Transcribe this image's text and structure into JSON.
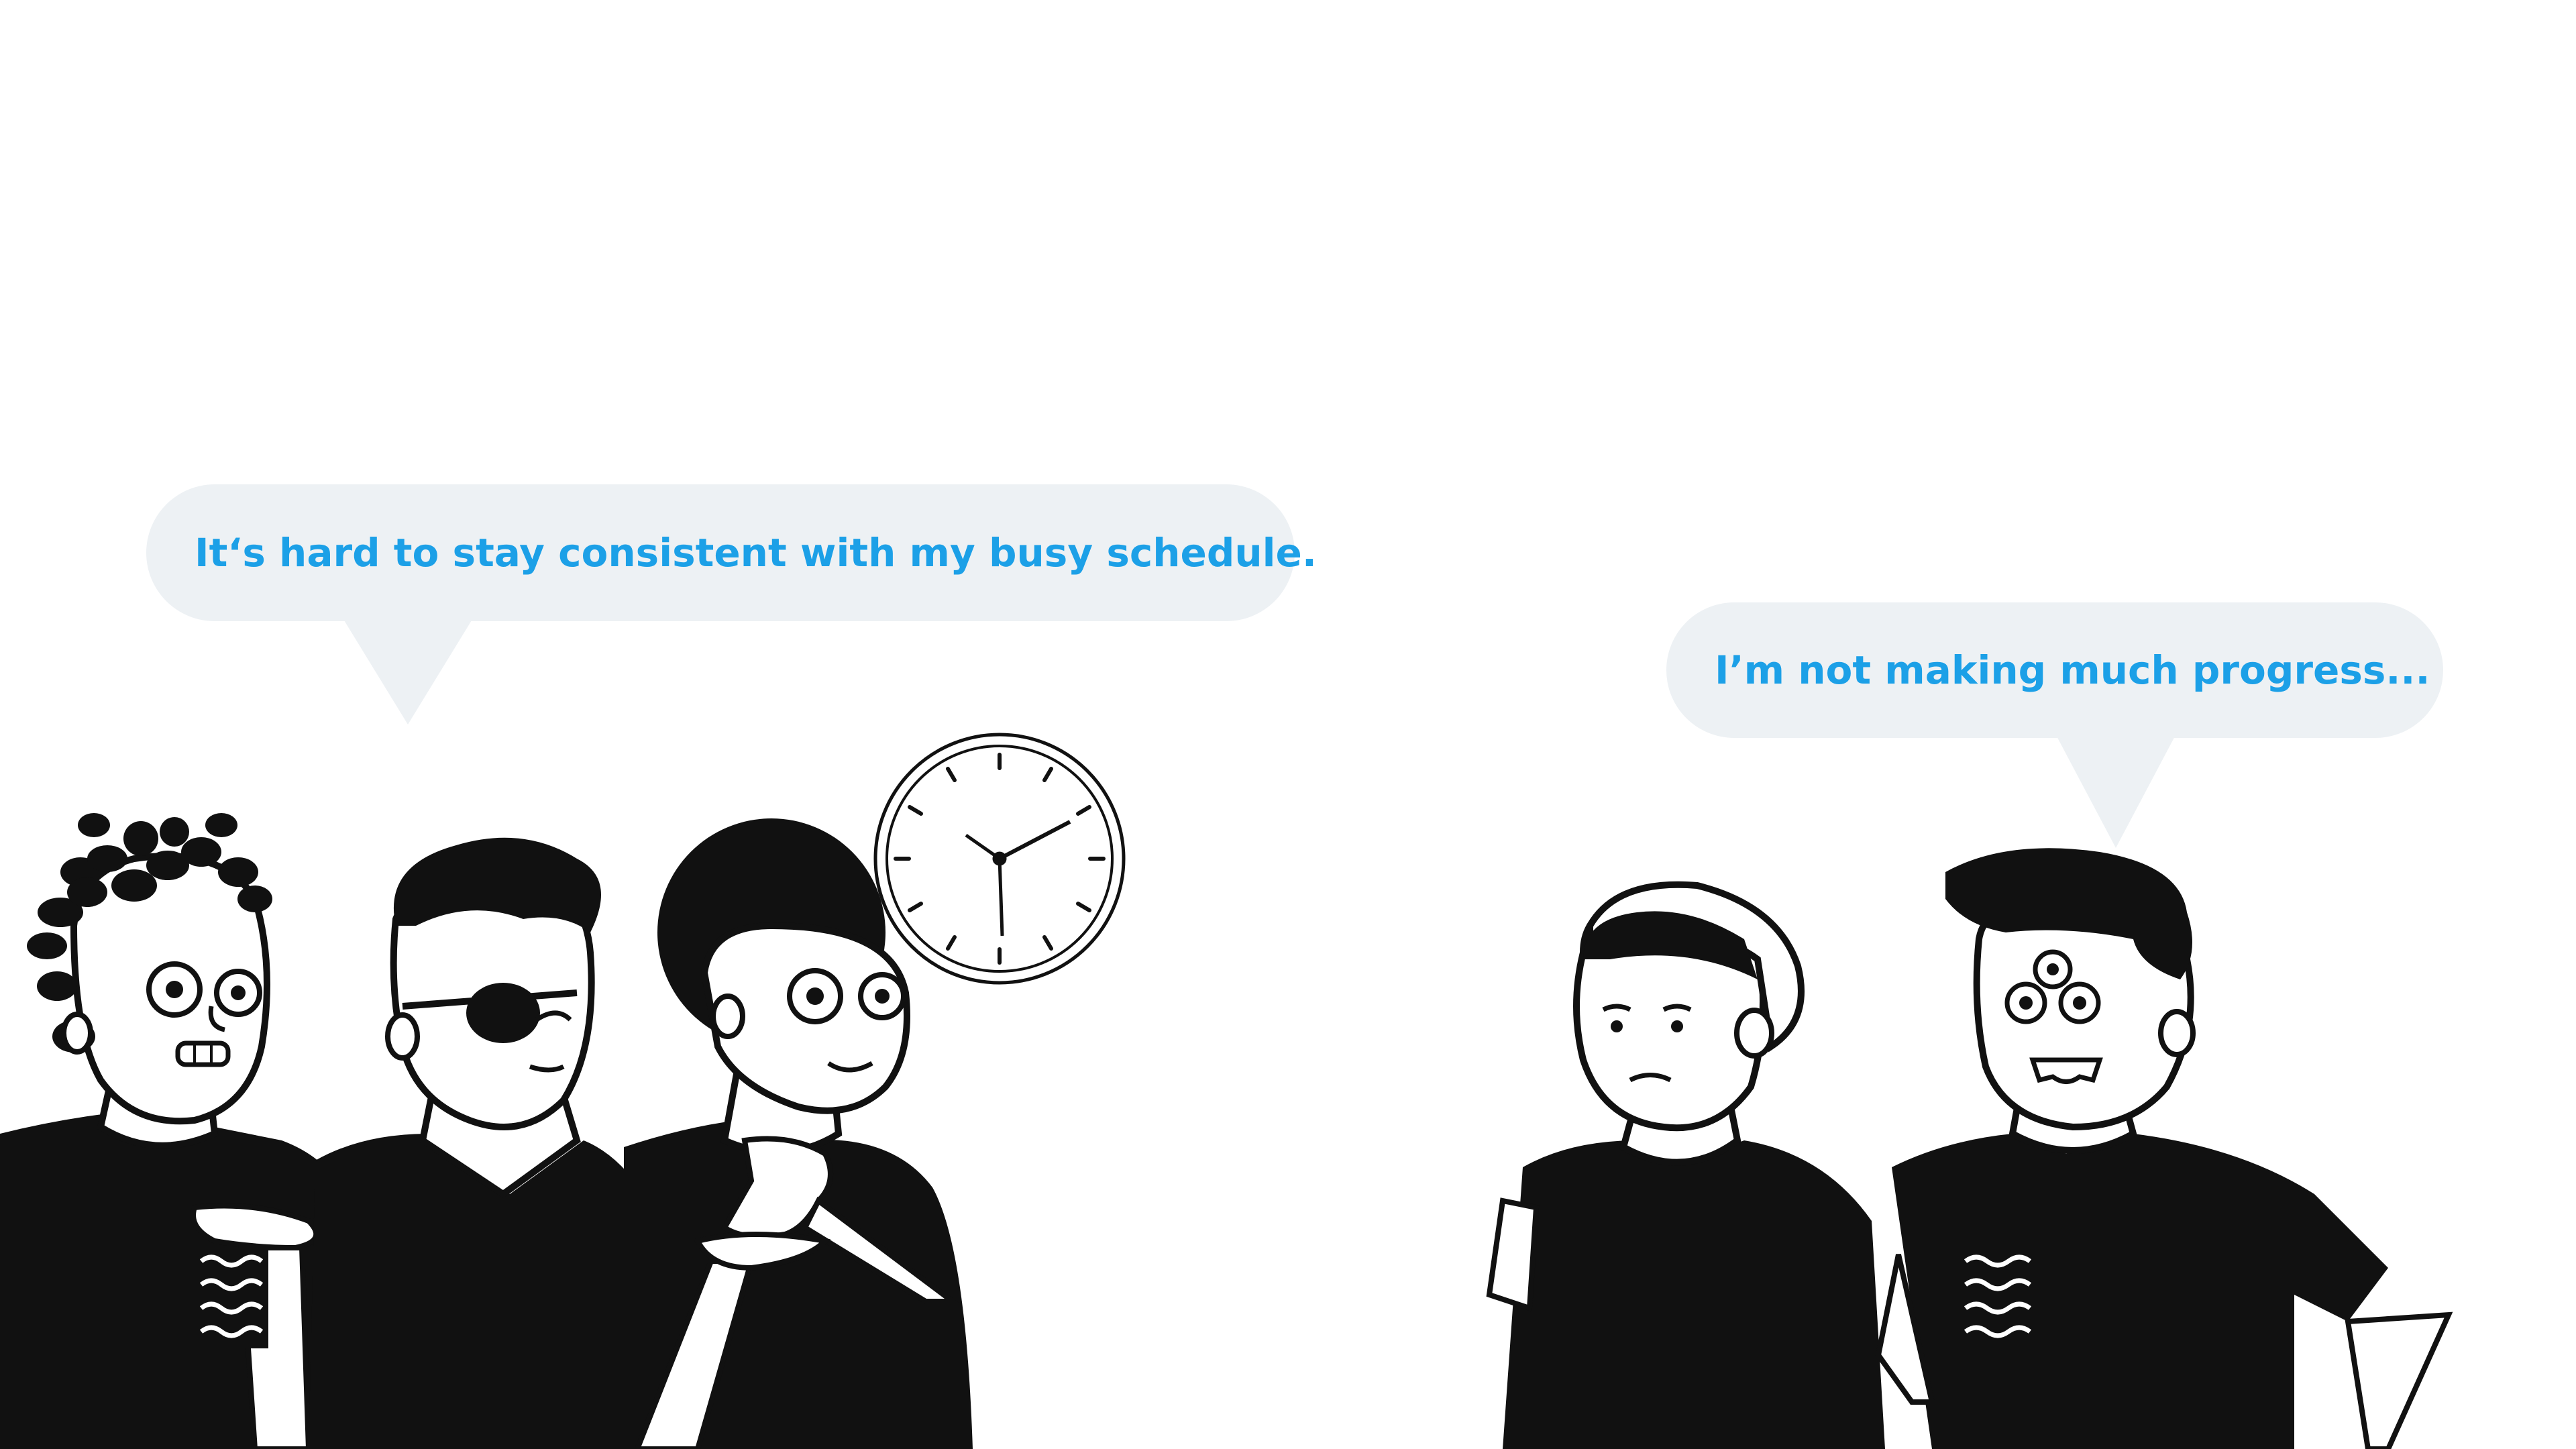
{
  "scene": {
    "background": "#ffffff",
    "bubble_fill": "#edf1f4",
    "text_color": "#1ca0e7"
  },
  "bubbles": [
    {
      "text": "It‘s hard to stay consistent with my busy schedule."
    },
    {
      "text": "I’m not making much progress..."
    }
  ],
  "figures": {
    "left_group": [
      "person-dreadlocks-icon",
      "person-eyepatch-icon",
      "person-afro-icon"
    ],
    "right_group": [
      "person-beanie-icon",
      "person-three-eyes-icon"
    ],
    "clock": "wall-clock-icon"
  }
}
